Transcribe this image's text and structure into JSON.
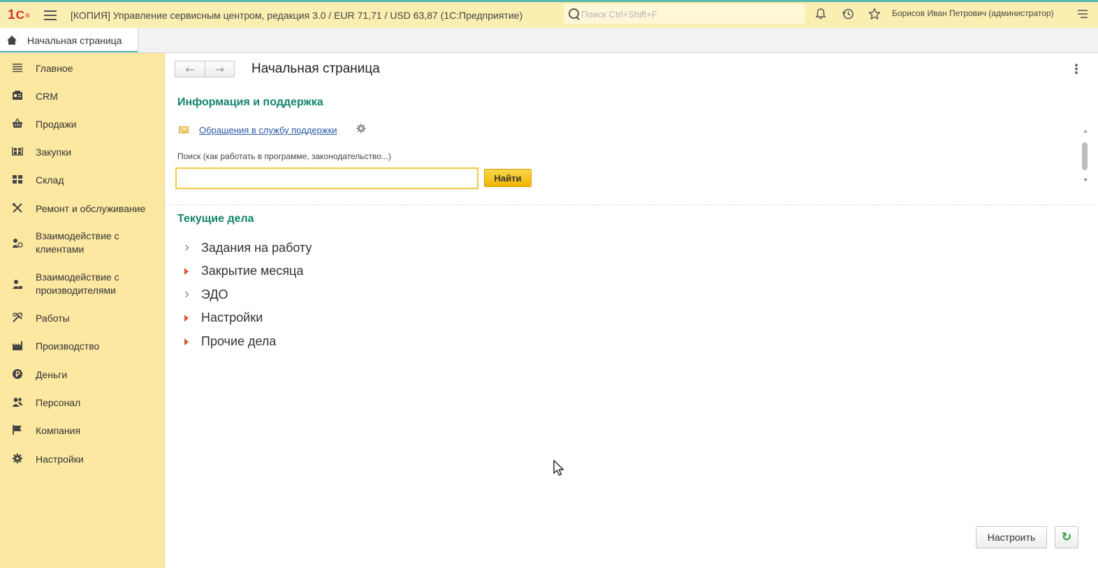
{
  "window": {
    "title": "[КОПИЯ] Управление сервисным центром, редакция 3.0 / EUR 71,71 / USD 63,87  (1С:Предприятие)",
    "search_placeholder": "Поиск Ctrl+Shift+F",
    "user": "Борисов Иван Петрович (администратор)",
    "icons": [
      "bell-icon",
      "history-icon",
      "star-icon",
      "menu-lines-icon"
    ]
  },
  "tabs": {
    "home": "Начальная страница"
  },
  "sidebar": {
    "items": [
      {
        "label": "Главное",
        "icon": "menu-icon"
      },
      {
        "label": "CRM",
        "icon": "crm-icon"
      },
      {
        "label": "Продажи",
        "icon": "basket-icon"
      },
      {
        "label": "Закупки",
        "icon": "purchases-icon"
      },
      {
        "label": "Склад",
        "icon": "warehouse-icon"
      },
      {
        "label": "Ремонт и обслуживание",
        "icon": "tools-icon"
      },
      {
        "label": "Взаимодействие с клиентами",
        "icon": "clients-icon"
      },
      {
        "label": "Взаимодействие с производителями",
        "icon": "producers-icon"
      },
      {
        "label": "Работы",
        "icon": "works-icon"
      },
      {
        "label": "Производство",
        "icon": "factory-icon"
      },
      {
        "label": "Деньги",
        "icon": "ruble-icon"
      },
      {
        "label": "Персонал",
        "icon": "staff-icon"
      },
      {
        "label": "Компания",
        "icon": "flag-icon"
      },
      {
        "label": "Настройки",
        "icon": "gear-icon"
      }
    ]
  },
  "main": {
    "title": "Начальная страница",
    "info_section": "Информация и поддержка",
    "support_link": "Обращения в службу поддержки",
    "search_caption": "Поиск (как работать в программе, законодательство...)",
    "search_value": "",
    "find_button": "Найти",
    "tasks_section": "Текущие дела",
    "tasks": [
      {
        "label": "Задания на работу",
        "marker": "chevron"
      },
      {
        "label": "Закрытие месяца",
        "marker": "triangle"
      },
      {
        "label": "ЭДО",
        "marker": "chevron"
      },
      {
        "label": "Настройки",
        "marker": "triangle"
      },
      {
        "label": "Прочие дела",
        "marker": "triangle"
      }
    ],
    "configure_button": "Настроить"
  },
  "colors": {
    "titlebar": "#fbeeb1",
    "sidebar": "#fde8a2",
    "section_heading": "#14846d",
    "accent_teal": "#59b8b0",
    "find_button": "#f0b400",
    "task_marker": "#e0532d"
  }
}
